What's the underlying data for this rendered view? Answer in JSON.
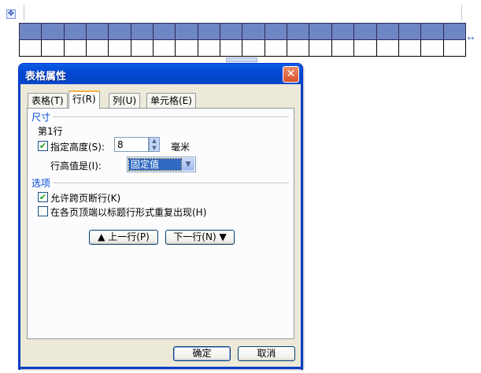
{
  "dialog": {
    "title": "表格属性",
    "close_glyph": "✕"
  },
  "tabs": [
    {
      "label": "表格(T)",
      "active": false
    },
    {
      "label": "行(R)",
      "active": true
    },
    {
      "label": "列(U)",
      "active": false
    },
    {
      "label": "单元格(E)",
      "active": false
    }
  ],
  "size_section": {
    "title": "尺寸",
    "row_label": "第1行",
    "specify_height_label": "指定高度(S):",
    "specify_height_checked": true,
    "height_value": "8",
    "height_unit": "毫米",
    "row_height_is_label": "行高值是(I):",
    "row_height_mode": "固定值"
  },
  "options_section": {
    "title": "选项",
    "allow_break_label": "允许跨页断行(K)",
    "allow_break_checked": true,
    "repeat_header_label": "在各页顶端以标题行形式重复出现(H)",
    "repeat_header_checked": false
  },
  "nav": {
    "prev_row_label": "▲ 上一行(P)",
    "next_row_label": "下一行(N) ▼"
  },
  "footer": {
    "ok_label": "确定",
    "cancel_label": "取消"
  },
  "document": {
    "move_handle_glyph": "✥",
    "resize_glyph": "↔",
    "table_columns": 20
  },
  "colors": {
    "title_bar": "#0548d6",
    "selected_row": "#6f86c4",
    "section_title": "#0046d5"
  }
}
